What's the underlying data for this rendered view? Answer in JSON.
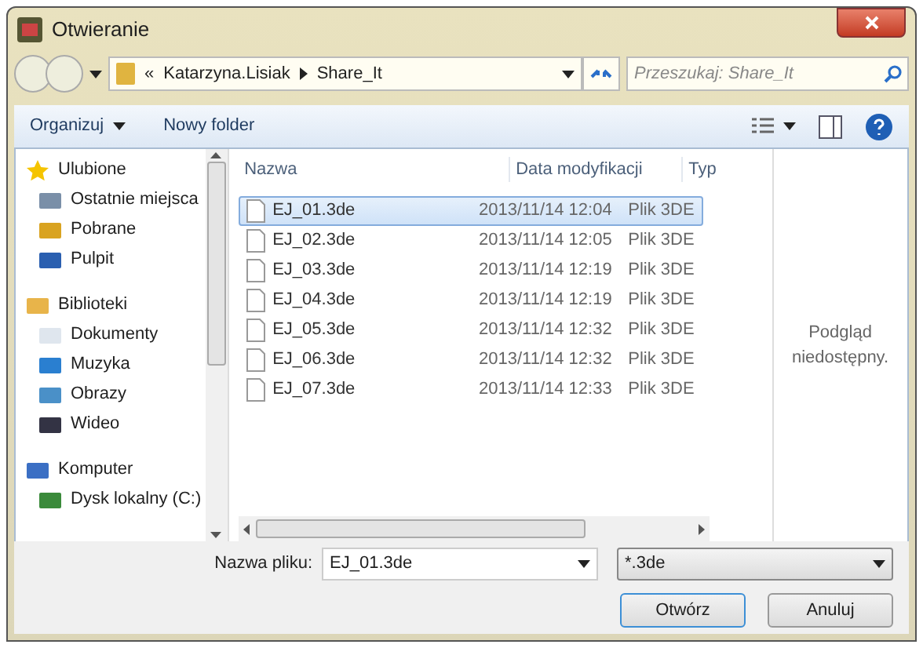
{
  "window": {
    "title": "Otwieranie"
  },
  "address_bar": {
    "overflow": "«",
    "path": [
      "Katarzyna.Lisiak",
      "Share_It"
    ]
  },
  "search": {
    "placeholder": "Przeszukaj: Share_It"
  },
  "toolbar": {
    "organize": "Organizuj",
    "new_folder": "Nowy folder"
  },
  "sidebar": {
    "items": [
      {
        "label": "Ulubione",
        "children": [
          {
            "label": "Ostatnie miejsca"
          },
          {
            "label": "Pobrane"
          },
          {
            "label": "Pulpit"
          }
        ]
      },
      {
        "label": "Biblioteki",
        "children": [
          {
            "label": "Dokumenty"
          },
          {
            "label": "Muzyka"
          },
          {
            "label": "Obrazy"
          },
          {
            "label": "Wideo"
          }
        ]
      },
      {
        "label": "Komputer",
        "children": [
          {
            "label": "Dysk lokalny (C:)"
          }
        ]
      }
    ]
  },
  "table": {
    "columns": [
      "Nazwa",
      "Data modyfikacji",
      "Typ"
    ],
    "rows": [
      {
        "name": "EJ_01.3de",
        "date": "2013/11/14 12:04",
        "type": "Plik 3DE",
        "selected": true
      },
      {
        "name": "EJ_02.3de",
        "date": "2013/11/14 12:05",
        "type": "Plik 3DE",
        "selected": false
      },
      {
        "name": "EJ_03.3de",
        "date": "2013/11/14 12:19",
        "type": "Plik 3DE",
        "selected": false
      },
      {
        "name": "EJ_04.3de",
        "date": "2013/11/14 12:19",
        "type": "Plik 3DE",
        "selected": false
      },
      {
        "name": "EJ_05.3de",
        "date": "2013/11/14 12:32",
        "type": "Plik 3DE",
        "selected": false
      },
      {
        "name": "EJ_06.3de",
        "date": "2013/11/14 12:32",
        "type": "Plik 3DE",
        "selected": false
      },
      {
        "name": "EJ_07.3de",
        "date": "2013/11/14 12:33",
        "type": "Plik 3DE",
        "selected": false
      }
    ]
  },
  "preview": {
    "message": "Podgląd niedostępny."
  },
  "filename": {
    "label": "Nazwa pliku:",
    "value": "EJ_01.3de"
  },
  "filter": {
    "value": "*.3de"
  },
  "buttons": [
    "Otwórz",
    "Anuluj"
  ]
}
